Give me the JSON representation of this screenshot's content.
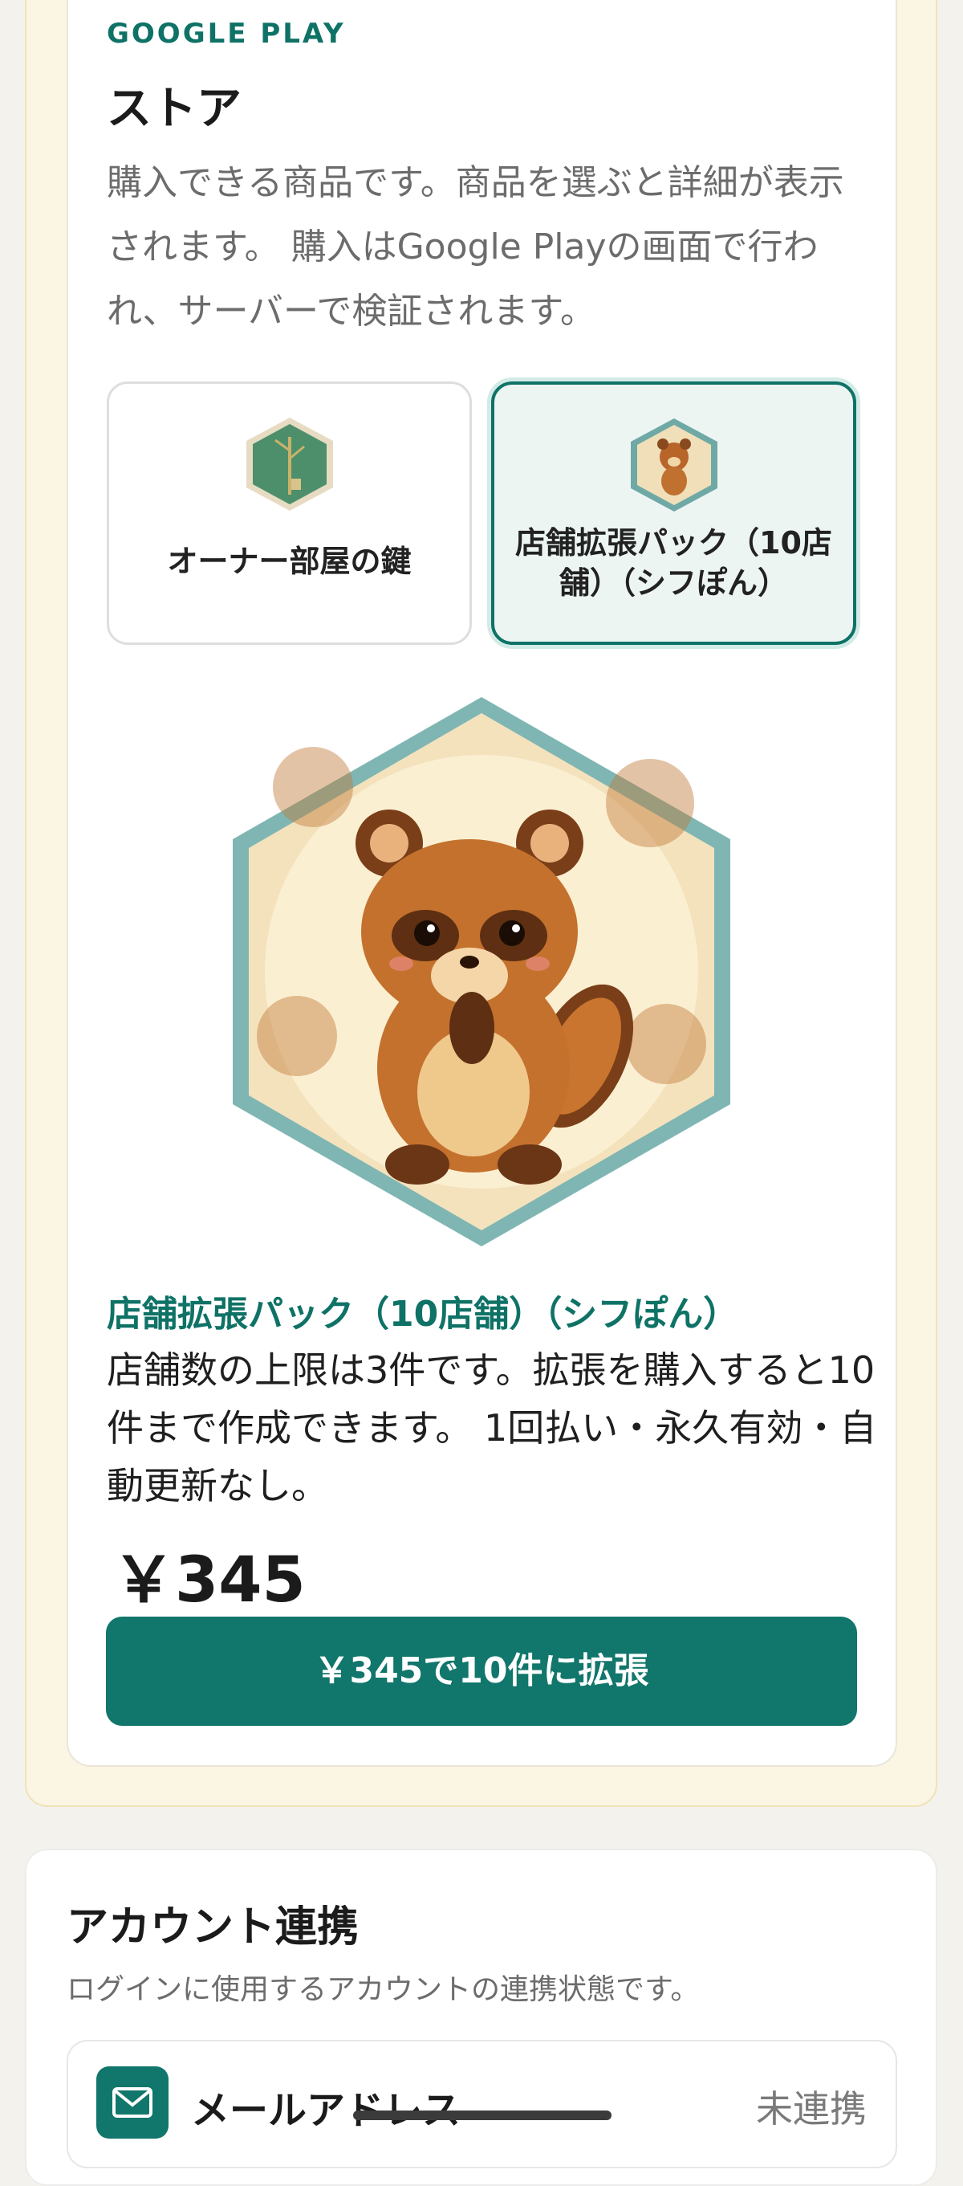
{
  "store": {
    "eyebrow": "GOOGLE PLAY",
    "title": "ストア",
    "description": "購入できる商品です。商品を選ぶと詳細が表示されます。 購入はGoogle Playの画面で行われ、サーバーで検証されます。",
    "products": [
      {
        "label": "オーナー部屋の鍵",
        "selected": false,
        "icon": "bamboo-key-hexagon-icon"
      },
      {
        "label": "店舗拡張パック（10店舗）（シフぽん）",
        "selected": true,
        "icon": "tanuki-hexagon-icon"
      }
    ],
    "detail": {
      "name": "店舗拡張パック（10店舗）（シフぽん）",
      "description": "店舗数の上限は3件です。拡張を購入すると10件まで作成できます。 1回払い・永久有効・自動更新なし。",
      "price": "￥345",
      "buy_label": "￥345で10件に拡張"
    }
  },
  "account": {
    "title": "アカウント連携",
    "subtitle": "ログインに使用するアカウントの連携状態です。",
    "rows": [
      {
        "label": "メールアドレス",
        "status": "未連携",
        "icon": "mail-icon"
      }
    ]
  },
  "colors": {
    "accent": "#0f7266",
    "panel": "#fbf6e4",
    "selected_bg": "#edf5f3"
  }
}
